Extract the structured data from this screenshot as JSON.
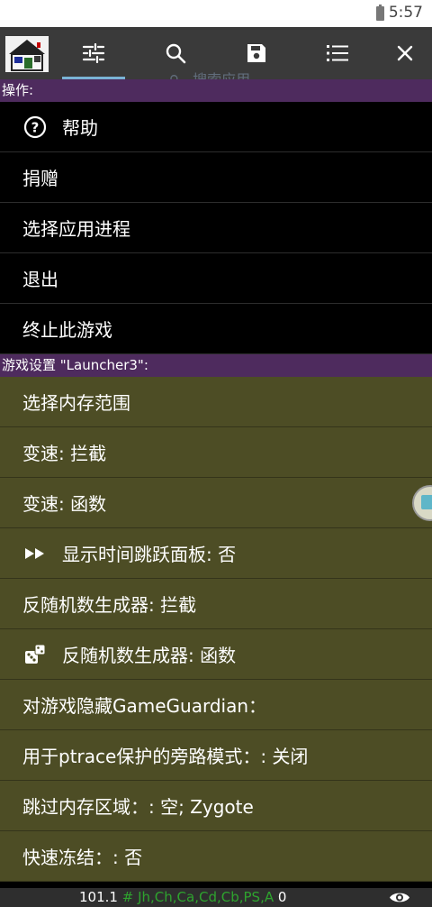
{
  "status": {
    "time": "5:57"
  },
  "toolbar": {
    "search_ghost": "搜索应用",
    "icons": [
      "app-logo-icon",
      "sliders-icon",
      "search-icon",
      "save-icon",
      "list-icon",
      "close-icon"
    ]
  },
  "ops": {
    "header": "操作:",
    "items": [
      "帮助",
      "捐赠",
      "选择应用进程",
      "退出",
      "终止此游戏"
    ]
  },
  "settings": {
    "header": "游戏设置 \"Launcher3\":",
    "items": [
      "选择内存范围",
      "变速: 拦截",
      "变速: 函数",
      "显示时间跳跃面板: 否",
      "反随机数生成器: 拦截",
      "反随机数生成器: 函数",
      "对游戏隐藏GameGuardian：",
      "用于ptrace保护的旁路模式：: 关闭",
      "跳过内存区域：: 空; Zygote",
      "快速冻结：: 否"
    ]
  },
  "bottom": {
    "version": "101.1",
    "hash": "#",
    "regions": "Jh,Ch,Ca,Cd,Cb,PS,A",
    "count": "0"
  },
  "colors": {
    "header_bg": "#4e2b5e",
    "settings_bg": "#4d4d25",
    "toolbar_bg": "#3a3a3a",
    "tab_indicator": "#7ab3d6",
    "hash_color": "#2ea32e"
  }
}
